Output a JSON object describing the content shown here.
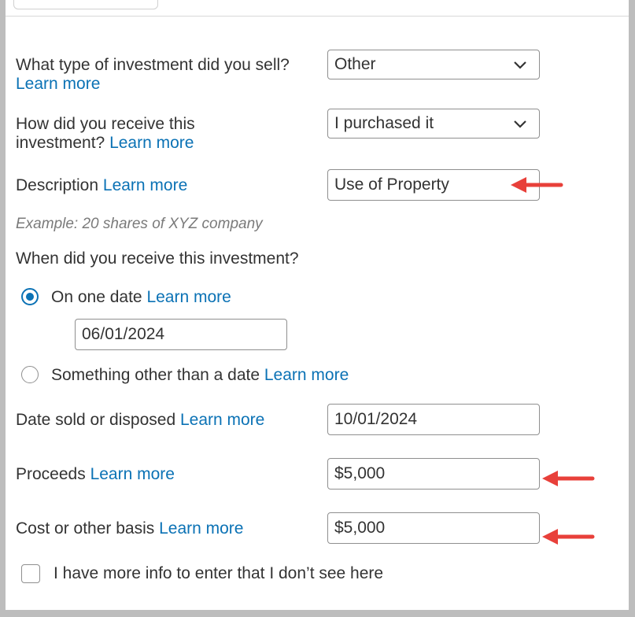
{
  "form": {
    "investment_type": {
      "question": "What type of investment did you sell?",
      "learn_more": "Learn more",
      "selected": "Other"
    },
    "received_how": {
      "question": "How did you receive this investment?",
      "learn_more": "Learn more",
      "selected": "I purchased it"
    },
    "description": {
      "label": "Description",
      "learn_more": "Learn more",
      "value": "Use of Property",
      "hint": "Example: 20 shares of XYZ company"
    },
    "received_when": {
      "question": "When did you receive this investment?",
      "options": [
        {
          "label": "On one date",
          "learn_more": "Learn more",
          "selected": true
        },
        {
          "label": "Something other than a date",
          "learn_more": "Learn more",
          "selected": false
        }
      ],
      "date_value": "06/01/2024"
    },
    "date_sold": {
      "label": "Date sold or disposed",
      "learn_more": "Learn more",
      "value": "10/01/2024"
    },
    "proceeds": {
      "label": "Proceeds",
      "learn_more": "Learn more",
      "value": "$5,000"
    },
    "cost_basis": {
      "label": "Cost or other basis",
      "learn_more": "Learn more",
      "value": "$5,000"
    },
    "more_info": {
      "label": "I have more info to enter that I don’t see here",
      "checked": false
    }
  },
  "annotations": {
    "arrow_color": "#e8403a"
  },
  "colors": {
    "link": "#0b72b5",
    "radio_selected": "#0b72b5"
  }
}
